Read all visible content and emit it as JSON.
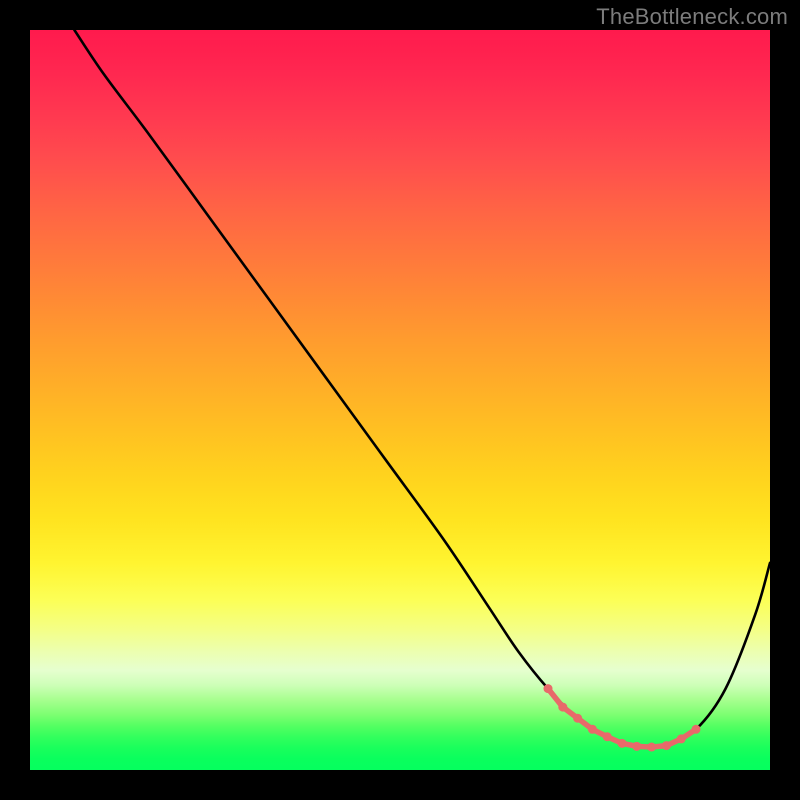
{
  "watermark": "TheBottleneck.com",
  "chart_data": {
    "type": "line",
    "title": "",
    "xlabel": "",
    "ylabel": "",
    "xlim": [
      0,
      100
    ],
    "ylim": [
      0,
      100
    ],
    "grid": false,
    "series": [
      {
        "name": "curve",
        "color": "#000000",
        "x": [
          6,
          10,
          16,
          24,
          32,
          40,
          48,
          56,
          62,
          66,
          70,
          74,
          78,
          82,
          86,
          90,
          94,
          98,
          100
        ],
        "y": [
          100,
          94,
          86,
          75,
          64,
          53,
          42,
          31,
          22,
          16,
          11,
          7,
          4.5,
          3.2,
          3.3,
          5.5,
          11,
          21,
          28
        ]
      }
    ],
    "markers": {
      "name": "highlight-segment",
      "color": "#e86a6a",
      "x": [
        70,
        72,
        74,
        76,
        78,
        80,
        82,
        84,
        86,
        88,
        90
      ],
      "y": [
        11,
        8.5,
        7,
        5.5,
        4.5,
        3.6,
        3.2,
        3.1,
        3.3,
        4.2,
        5.5
      ]
    },
    "background": {
      "type": "vertical-gradient",
      "stops": [
        {
          "pos": 0,
          "color": "#ff1a4d"
        },
        {
          "pos": 50,
          "color": "#ffae28"
        },
        {
          "pos": 75,
          "color": "#fcff56"
        },
        {
          "pos": 90,
          "color": "#a7ff8f"
        },
        {
          "pos": 100,
          "color": "#05ff5e"
        }
      ]
    }
  }
}
